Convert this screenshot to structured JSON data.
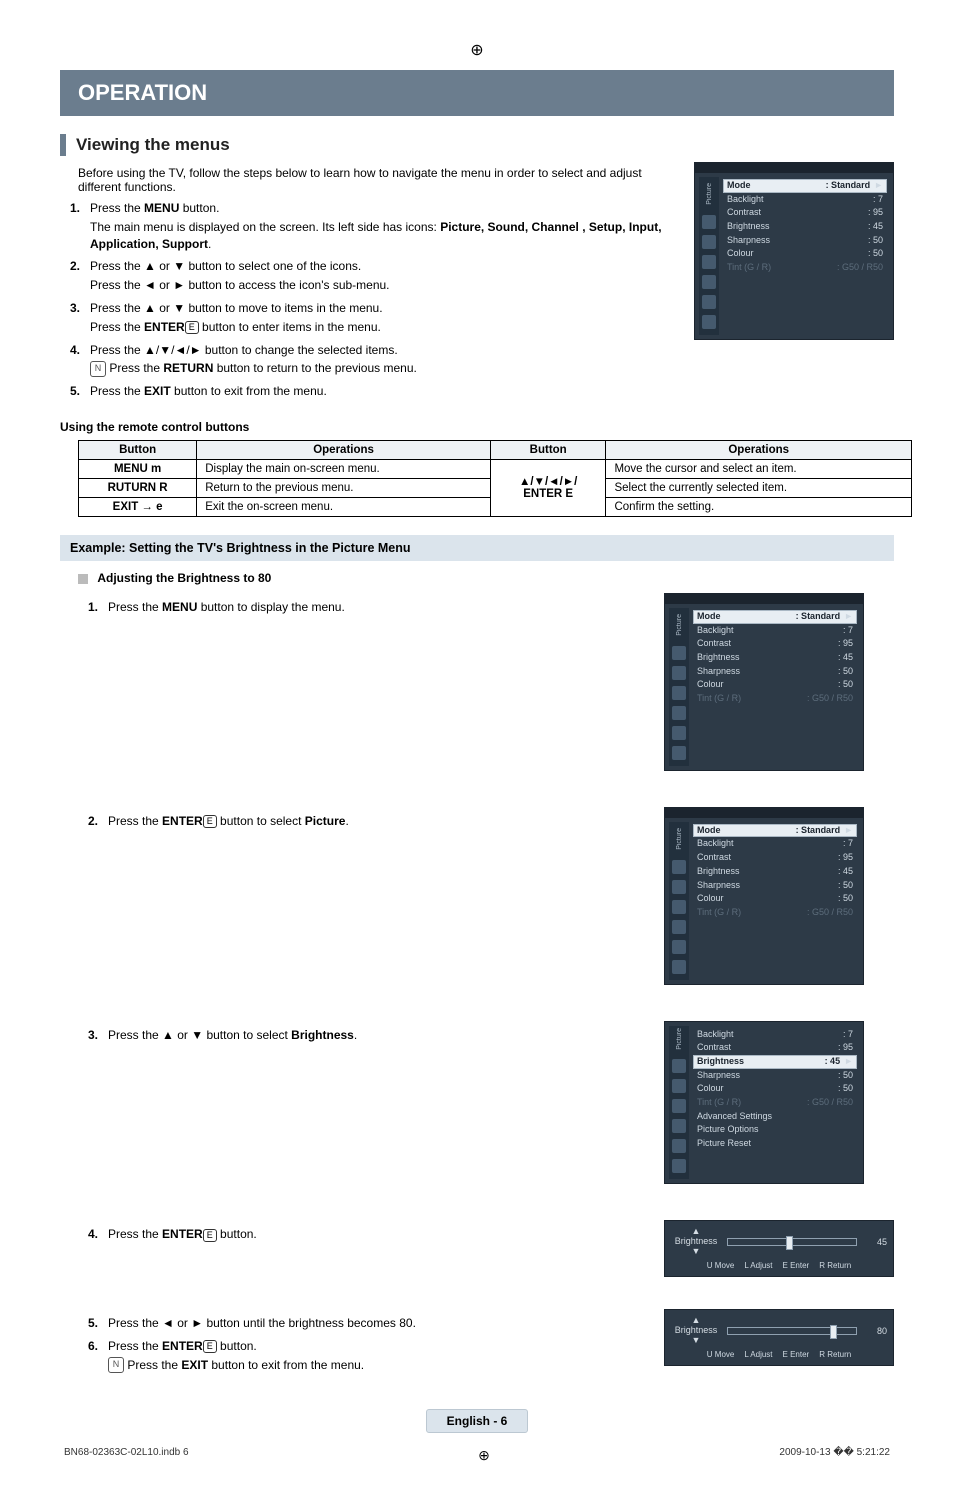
{
  "title_bar": "OPERATION",
  "section_title": "Viewing the menus",
  "intro": "Before using the TV, follow the steps below to learn how to navigate the menu in order to select and adjust different functions.",
  "steps": [
    {
      "num": "1.",
      "body_parts": [
        "Press the ",
        "MENU",
        " button."
      ],
      "sub": [
        "The main menu is displayed on the screen. Its left side has icons: ",
        "Picture, Sound, Channel , Setup, Input, Application, Support",
        "."
      ]
    },
    {
      "num": "2.",
      "body_parts": [
        "Press the ▲ or ▼ button to select one of the icons."
      ],
      "sub": [
        "Press the ◄ or ► button to access the icon's sub-menu."
      ]
    },
    {
      "num": "3.",
      "body_parts": [
        "Press the ▲ or ▼ button to move to items in the menu."
      ],
      "sub": [
        "Press the ",
        "ENTER",
        "E",
        " button to enter items in the menu."
      ]
    },
    {
      "num": "4.",
      "body_parts": [
        "Press the ▲/▼/◄/► button to change the selected items."
      ],
      "note": [
        "Press the ",
        "RETURN",
        " button to return to the previous menu."
      ]
    },
    {
      "num": "5.",
      "body_parts": [
        "Press the ",
        "EXIT",
        " button to exit from the menu."
      ]
    }
  ],
  "subsection_remote_title": "Using the remote control buttons",
  "remote_table": {
    "headers": [
      "Button",
      "Operations",
      "Button",
      "Operations"
    ],
    "rows_left": [
      {
        "btn": "MENU m",
        "op": "Display the main on-screen menu."
      },
      {
        "btn": "RUTURN R",
        "op": "Return to the previous menu."
      },
      {
        "btn": "EXIT → e",
        "op": "Exit the on-screen menu."
      }
    ],
    "right_buttons": "▲/▼/◄/►/\nENTER E",
    "right_ops": [
      "Move the cursor and select an item.",
      "Select the currently selected item.",
      "Confirm the setting."
    ]
  },
  "example_head": "Example: Setting the TV's Brightness in the Picture Menu",
  "adjust_title": "Adjusting the Brightness to 80",
  "example_steps": {
    "s1": {
      "num": "1.",
      "parts": [
        "Press the ",
        "MENU",
        " button to display the menu."
      ]
    },
    "s2": {
      "num": "2.",
      "parts": [
        "Press the ",
        "ENTER",
        "E",
        " button to select ",
        "Picture",
        "."
      ]
    },
    "s3": {
      "num": "3.",
      "parts": [
        "Press the ▲ or ▼ button to select ",
        "Brightness",
        "."
      ]
    },
    "s4": {
      "num": "4.",
      "parts": [
        "Press the ",
        "ENTER",
        "E",
        " button."
      ]
    },
    "s5": {
      "num": "5.",
      "parts": [
        "Press the ◄ or ► button until the brightness becomes 80."
      ]
    },
    "s6": {
      "num": "6.",
      "parts": [
        "Press the ",
        "ENTER",
        "E",
        " button."
      ],
      "note": [
        "Press the ",
        "EXIT",
        " button to exit from the menu."
      ]
    }
  },
  "osd": {
    "sidebar_label": "Picture",
    "mode_row": {
      "k": "Mode",
      "v": ": Standard"
    },
    "items": [
      {
        "k": "Backlight",
        "v": ": 7"
      },
      {
        "k": "Contrast",
        "v": ": 95"
      },
      {
        "k": "Brightness",
        "v": ": 45"
      },
      {
        "k": "Sharpness",
        "v": ": 50"
      },
      {
        "k": "Colour",
        "v": ": 50"
      },
      {
        "k": "Tint (G / R)",
        "v": ": G50 / R50"
      }
    ],
    "brightness_menu": {
      "pre": [
        {
          "k": "Backlight",
          "v": ": 7"
        },
        {
          "k": "Contrast",
          "v": ": 95"
        }
      ],
      "hl": {
        "k": "Brightness",
        "v": ": 45"
      },
      "post": [
        {
          "k": "Sharpness",
          "v": ": 50"
        },
        {
          "k": "Colour",
          "v": ": 50"
        },
        {
          "k": "Tint (G / R)",
          "v": ": G50 / R50"
        },
        {
          "k": "Advanced Settings",
          "v": ""
        },
        {
          "k": "Picture Options",
          "v": ""
        },
        {
          "k": "Picture Reset",
          "v": ""
        }
      ]
    }
  },
  "slider": {
    "label": "Brightness",
    "val45": "45",
    "val80": "80",
    "hints": {
      "move": "U Move",
      "adjust": "L Adjust",
      "enter": "E Enter",
      "return": "R Return"
    }
  },
  "footer_page": "English - 6",
  "bottom_left": "BN68-02363C-02L10.indb   6",
  "bottom_right": "2009-10-13   �� 5:21:22"
}
